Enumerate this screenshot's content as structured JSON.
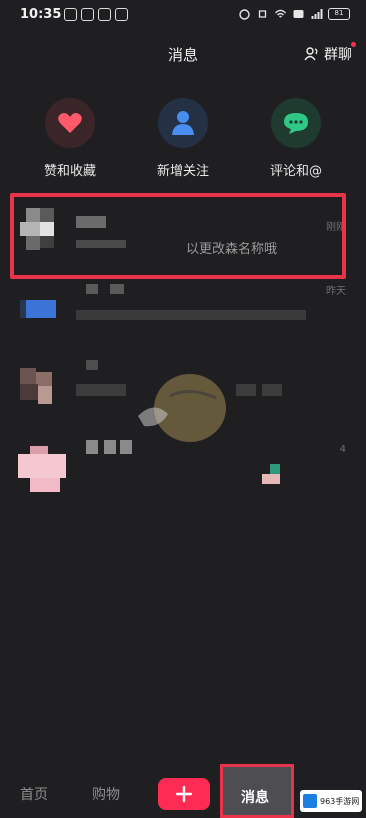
{
  "status_bar": {
    "time": "10:35",
    "battery": "81"
  },
  "header": {
    "title": "消息",
    "group_chat_label": "群聊"
  },
  "shortcuts": [
    {
      "label": "赞和收藏",
      "icon": "heart-icon",
      "color": "#ff5a6a",
      "bg": "#3a2528"
    },
    {
      "label": "新增关注",
      "icon": "person-icon",
      "color": "#4a8df0",
      "bg": "#243044"
    },
    {
      "label": "评论和@",
      "icon": "comment-icon",
      "color": "#2fc887",
      "bg": "#1f3a2e"
    }
  ],
  "messages": [
    {
      "time": "刚刚",
      "preview": "以更改森名称哦"
    },
    {
      "time": "昨天",
      "preview": ""
    },
    {
      "time": "",
      "preview": ""
    },
    {
      "time": "4",
      "preview": ""
    }
  ],
  "bottom_nav": {
    "home": "首页",
    "shop": "购物",
    "messages": "消息",
    "site_badge": "963手游网"
  },
  "colors": {
    "highlight": "#e8334b",
    "accent": "#fe2c55",
    "background": "#1f1f22"
  }
}
